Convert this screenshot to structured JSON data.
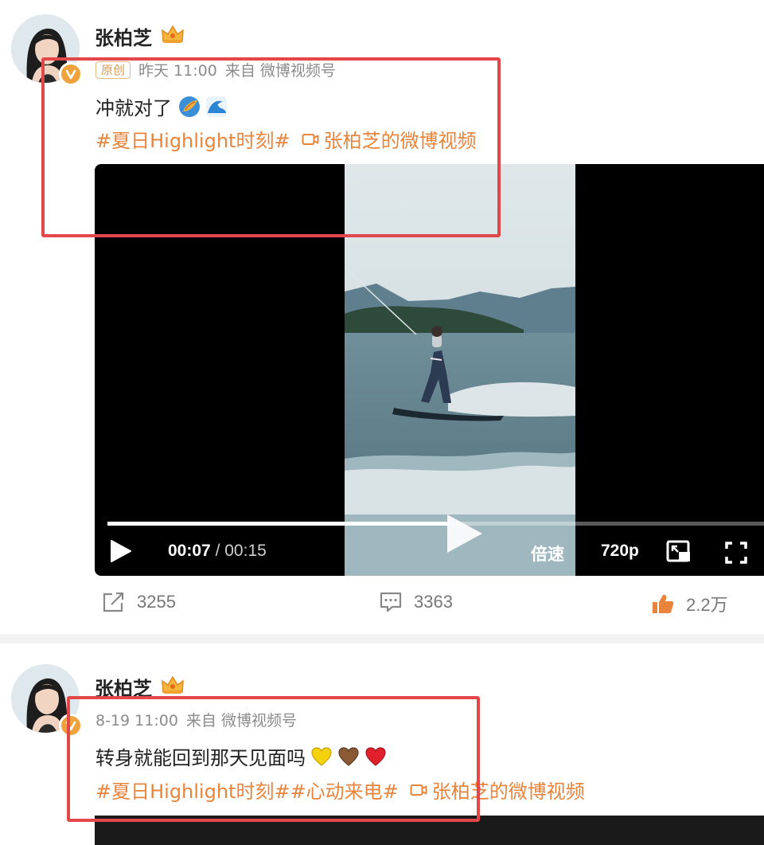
{
  "posts": [
    {
      "author": "张柏芝",
      "original_tag": "原创",
      "time": "昨天 11:00",
      "source_prefix": "来自",
      "source": "微博视频号",
      "text": "冲就对了",
      "emojis": [
        "surfboard-emoji",
        "wave-emoji"
      ],
      "topic": "#夏日Highlight时刻#",
      "video_link": "张柏芝的微博视频",
      "video": {
        "current_time": "00:07",
        "separator": "/",
        "duration": "00:15",
        "progress_fraction": 0.52,
        "speed_label": "倍速",
        "quality_label": "720p"
      },
      "actions": {
        "reposts": "3255",
        "comments": "3363",
        "likes": "2.2万"
      }
    },
    {
      "author": "张柏芝",
      "time": "8-19 11:00",
      "source_prefix": "来自",
      "source": "微博视频号",
      "text": "转身就能回到那天见面吗",
      "emojis": [
        "yellow-heart-emoji",
        "brown-heart-emoji",
        "red-heart-emoji"
      ],
      "topic": "#夏日Highlight时刻##心动来电#",
      "video_link": "张柏芝的微博视频"
    }
  ],
  "colors": {
    "topic": "#e8843c",
    "highlight_box": "#e4474a",
    "verified_badge": "#f0a23b",
    "like_icon": "#e8843c"
  }
}
